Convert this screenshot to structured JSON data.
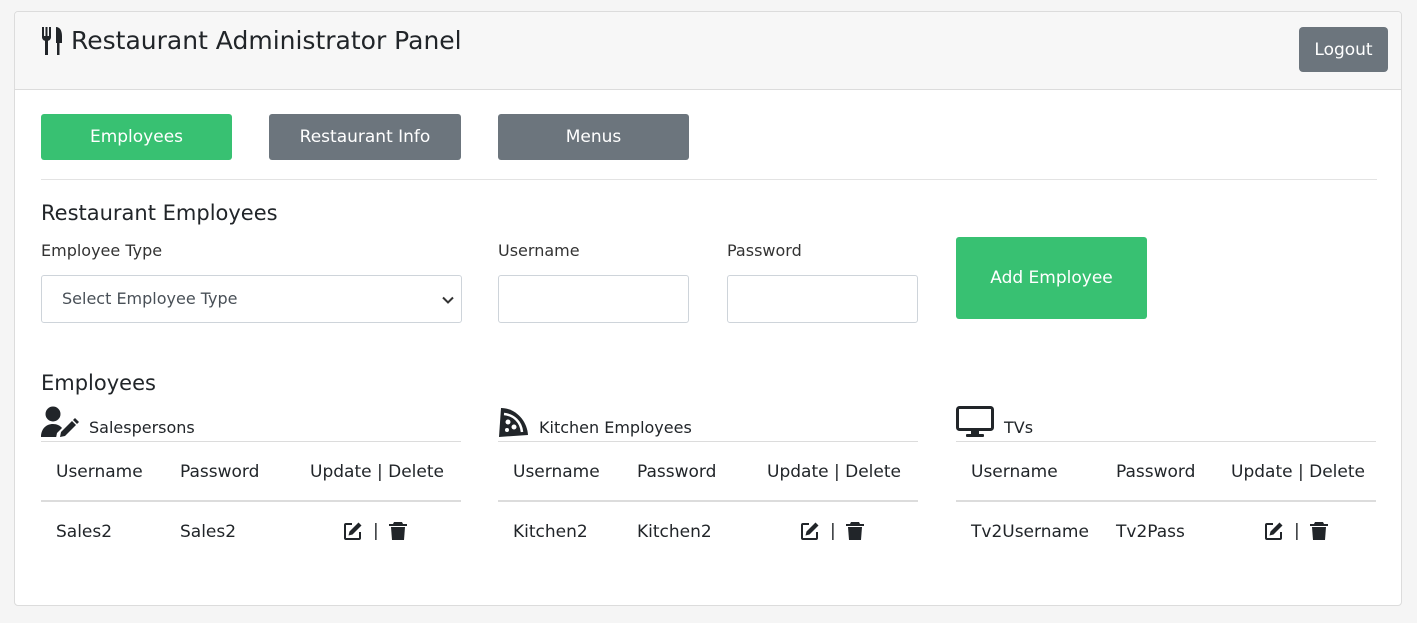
{
  "header": {
    "title": "Restaurant Administrator Panel",
    "logout_label": "Logout",
    "icon": "utensils-icon"
  },
  "nav": {
    "employees_label": "Employees",
    "restaurant_info_label": "Restaurant Info",
    "menus_label": "Menus"
  },
  "form": {
    "section_title": "Restaurant Employees",
    "employee_type_label": "Employee Type",
    "employee_type_value": "Select Employee Type",
    "username_label": "Username",
    "username_value": "",
    "password_label": "Password",
    "password_value": "",
    "add_label": "Add Employee"
  },
  "employees": {
    "section_title": "Employees",
    "groups": [
      {
        "title": "Salespersons",
        "icon": "user-edit-icon",
        "headers": [
          "Username",
          "Password",
          "Update | Delete"
        ],
        "rows": [
          {
            "username": "Sales2",
            "password": "Sales2"
          }
        ]
      },
      {
        "title": "Kitchen Employees",
        "icon": "pizza-slice-icon",
        "headers": [
          "Username",
          "Password",
          "Update | Delete"
        ],
        "rows": [
          {
            "username": "Kitchen2",
            "password": "Kitchen2"
          }
        ]
      },
      {
        "title": "TVs",
        "icon": "desktop-icon",
        "headers": [
          "Username",
          "Password",
          "Update | Delete"
        ],
        "rows": [
          {
            "username": "Tv2Username",
            "password": "Tv2Pass"
          }
        ]
      }
    ],
    "separator": "|"
  },
  "colors": {
    "primary_green": "#38c172",
    "secondary_gray": "#6c757d"
  }
}
